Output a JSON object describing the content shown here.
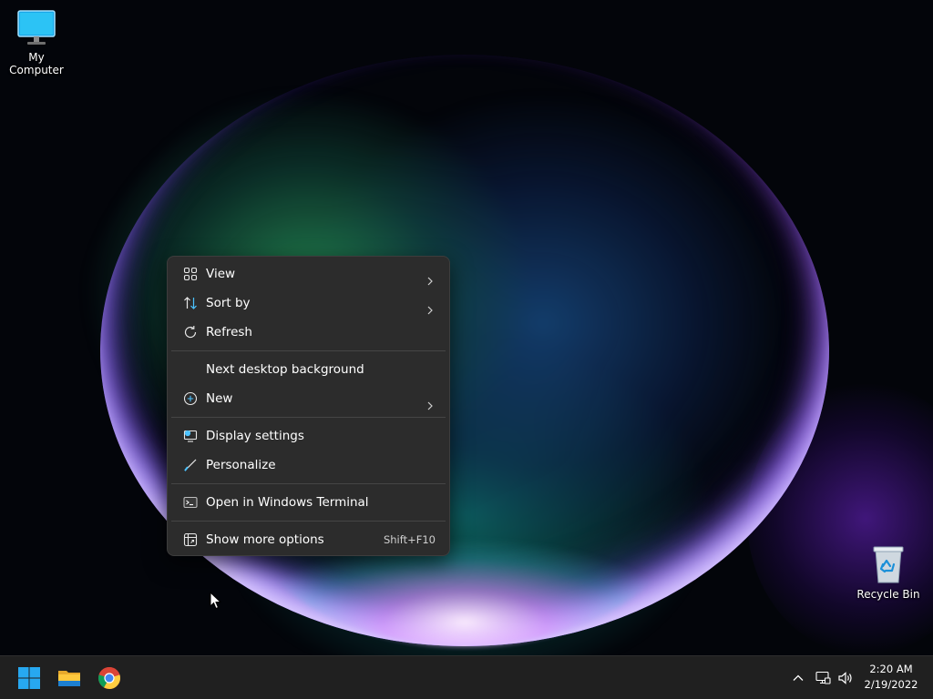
{
  "desktop": {
    "icons": [
      {
        "label": "My Computer",
        "icon": "computer-icon"
      },
      {
        "label": "Recycle Bin",
        "icon": "recycle-bin-icon"
      }
    ]
  },
  "context_menu": {
    "items": [
      {
        "label": "View",
        "icon": "view-grid-icon",
        "submenu": true
      },
      {
        "label": "Sort by",
        "icon": "sort-icon",
        "submenu": true
      },
      {
        "label": "Refresh",
        "icon": "refresh-icon"
      },
      {
        "label": "Next desktop background",
        "icon": ""
      },
      {
        "label": "New",
        "icon": "new-plus-icon",
        "submenu": true
      },
      {
        "label": "Display settings",
        "icon": "display-settings-icon"
      },
      {
        "label": "Personalize",
        "icon": "brush-icon"
      },
      {
        "label": "Open in Windows Terminal",
        "icon": "terminal-icon"
      },
      {
        "label": "Show more options",
        "icon": "more-options-icon",
        "shortcut": "Shift+F10"
      }
    ]
  },
  "taskbar": {
    "pinned": [
      {
        "name": "Start",
        "icon": "windows-logo-icon"
      },
      {
        "name": "File Explorer",
        "icon": "folder-icon"
      },
      {
        "name": "Google Chrome",
        "icon": "chrome-icon"
      }
    ],
    "tray": {
      "icons": [
        "chevron-up-icon",
        "network-icon",
        "volume-icon"
      ],
      "time": "2:20 AM",
      "date": "2/19/2022"
    }
  },
  "colors": {
    "menu_bg": "#2c2c2c",
    "taskbar_bg": "#202020",
    "accent": "#0078d4"
  }
}
